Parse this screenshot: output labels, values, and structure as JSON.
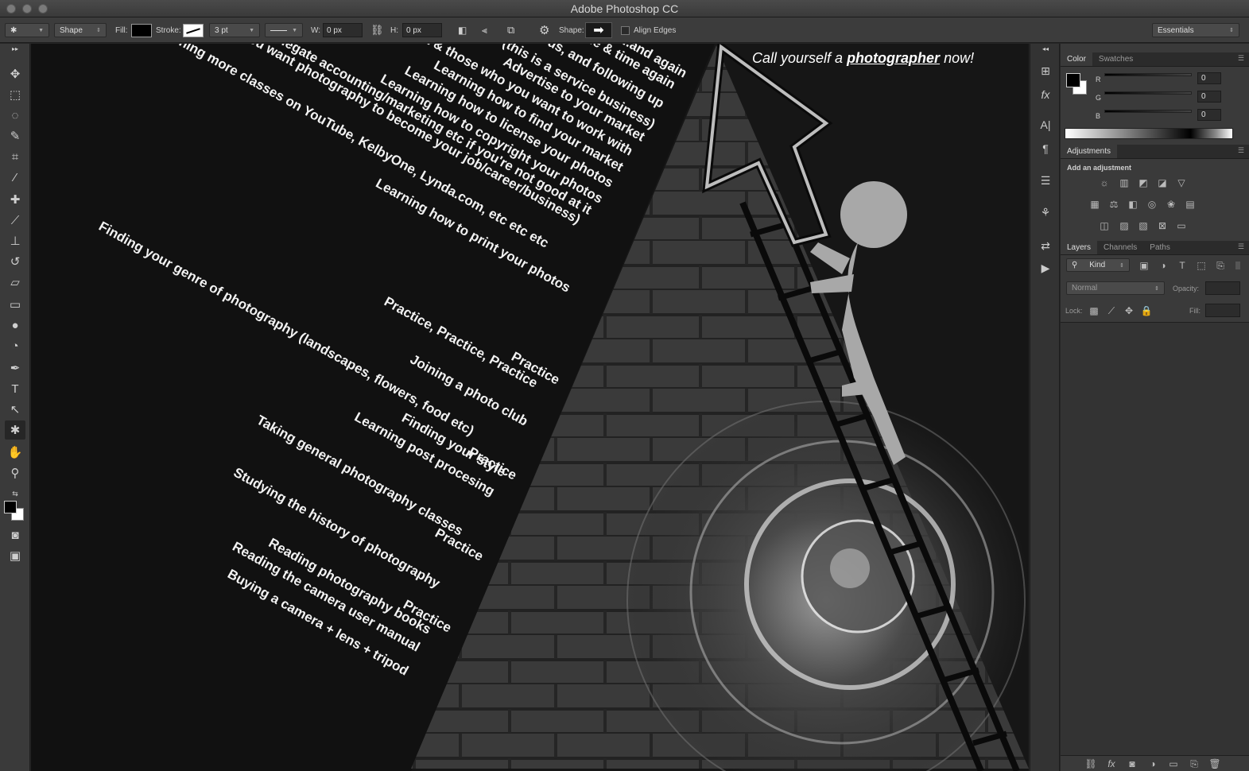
{
  "app": {
    "title": "Adobe Photoshop CC"
  },
  "options": {
    "mode": "Shape",
    "fill_label": "Fill:",
    "stroke_label": "Stroke:",
    "stroke_width": "3 pt",
    "w_label": "W:",
    "w_value": "0 px",
    "h_label": "H:",
    "h_value": "0 px",
    "shape_label": "Shape:",
    "align_edges": "Align Edges",
    "workspace": "Essentials"
  },
  "canvas": {
    "tagline_prefix": "Call yourself a ",
    "tagline_word": "photographer",
    "tagline_suffix": " now!",
    "steps": [
      "....and again",
      "Producing amazing work time & time again",
      "Being courteous, and following up",
      "Being customer oriented (this is a service business)",
      "Advertise to your market",
      "Focusing on your market & those who you want to work with",
      "Learning how to find your market",
      "Learning how to license your photos",
      "Learning how to copyright your photos",
      "Learning to delegate accounting/marketing etc if you're not good at it",
      "Learning the business side (if you want photography to become your job/career/business)",
      "Learning how to print your photos",
      "Practice",
      "Watching more classes on YouTube, KelbyOne, Lynda.com, etc etc etc",
      "Practice, Practice, Practice",
      "Joining a photo club",
      "Practice",
      "Finding your style",
      "Learning post procesing",
      "Practice",
      "Finding your genre of photography (landscapes, flowers, food etc)",
      "Taking general photography classes",
      "Practice",
      "Studying the history of photography",
      "Reading photography books",
      "Reading the camera user manual",
      "Buying a camera + lens + tripod"
    ]
  },
  "color_panel": {
    "tabs": [
      "Color",
      "Swatches"
    ],
    "channels": [
      {
        "name": "R",
        "value": "0"
      },
      {
        "name": "G",
        "value": "0"
      },
      {
        "name": "B",
        "value": "0"
      }
    ]
  },
  "adjustments_panel": {
    "tab": "Adjustments",
    "subtitle": "Add an adjustment"
  },
  "layers_panel": {
    "tabs": [
      "Layers",
      "Channels",
      "Paths"
    ],
    "filter": "Kind",
    "blend_mode": "Normal",
    "opacity_label": "Opacity:",
    "lock_label": "Lock:",
    "fill_label": "Fill:"
  }
}
